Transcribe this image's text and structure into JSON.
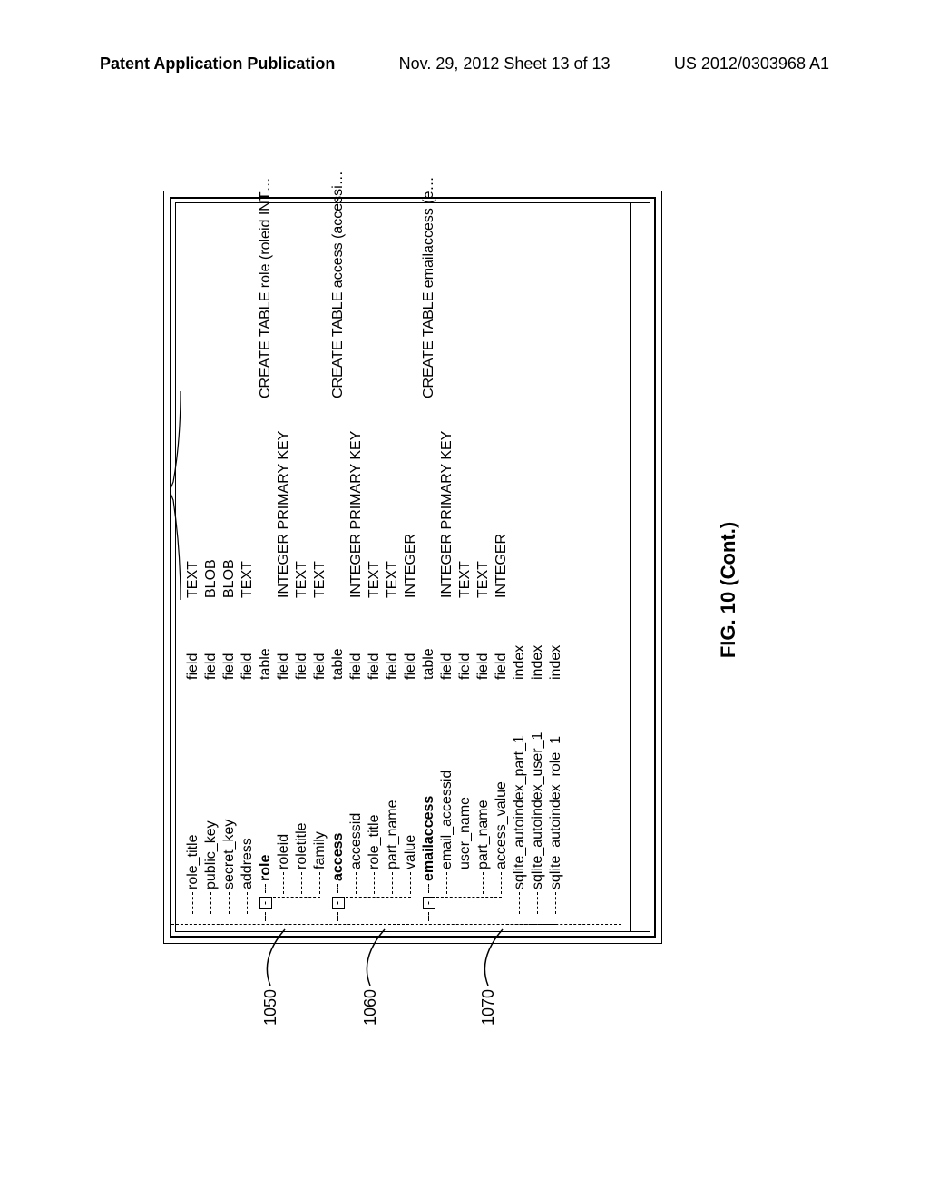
{
  "header": {
    "left": "Patent Application Publication",
    "middle": "Nov. 29, 2012  Sheet 13 of 13",
    "right": "US 2012/0303968 A1"
  },
  "caption": "FIG. 10 (Cont.)",
  "refs": {
    "r1050": "1050",
    "r1060": "1060",
    "r1070": "1070"
  },
  "toggle": "-",
  "parent_fields": [
    {
      "name": "role_title",
      "kind": "field",
      "dtype": "TEXT"
    },
    {
      "name": "public_key",
      "kind": "field",
      "dtype": "BLOB"
    },
    {
      "name": "secret_key",
      "kind": "field",
      "dtype": "BLOB"
    },
    {
      "name": "address",
      "kind": "field",
      "dtype": "TEXT"
    }
  ],
  "tables": [
    {
      "name": "role",
      "kind": "table",
      "sql": "CREATE TABLE role (roleid INT…",
      "fields": [
        {
          "name": "roleid",
          "kind": "field",
          "dtype": "INTEGER PRIMARY KEY"
        },
        {
          "name": "roletitle",
          "kind": "field",
          "dtype": "TEXT"
        },
        {
          "name": "family",
          "kind": "field",
          "dtype": "TEXT"
        }
      ]
    },
    {
      "name": "access",
      "kind": "table",
      "sql": "CREATE TABLE access (accessi…",
      "fields": [
        {
          "name": "accessid",
          "kind": "field",
          "dtype": "INTEGER PRIMARY KEY"
        },
        {
          "name": "role_title",
          "kind": "field",
          "dtype": "TEXT"
        },
        {
          "name": "part_name",
          "kind": "field",
          "dtype": "TEXT"
        },
        {
          "name": "value",
          "kind": "field",
          "dtype": "INTEGER"
        }
      ]
    },
    {
      "name": "emailaccess",
      "kind": "table",
      "sql": "CREATE TABLE emailaccess (e…",
      "fields": [
        {
          "name": "email_accessid",
          "kind": "field",
          "dtype": "INTEGER PRIMARY KEY"
        },
        {
          "name": "user_name",
          "kind": "field",
          "dtype": "TEXT"
        },
        {
          "name": "part_name",
          "kind": "field",
          "dtype": "TEXT"
        },
        {
          "name": "access_value",
          "kind": "field",
          "dtype": "INTEGER"
        }
      ]
    }
  ],
  "indexes": [
    {
      "name": "sqlite_autoindex_part_1",
      "kind": "index"
    },
    {
      "name": "sqlite_autoindex_user_1",
      "kind": "index"
    },
    {
      "name": "sqlite_autoindex_role_1",
      "kind": "index"
    }
  ]
}
